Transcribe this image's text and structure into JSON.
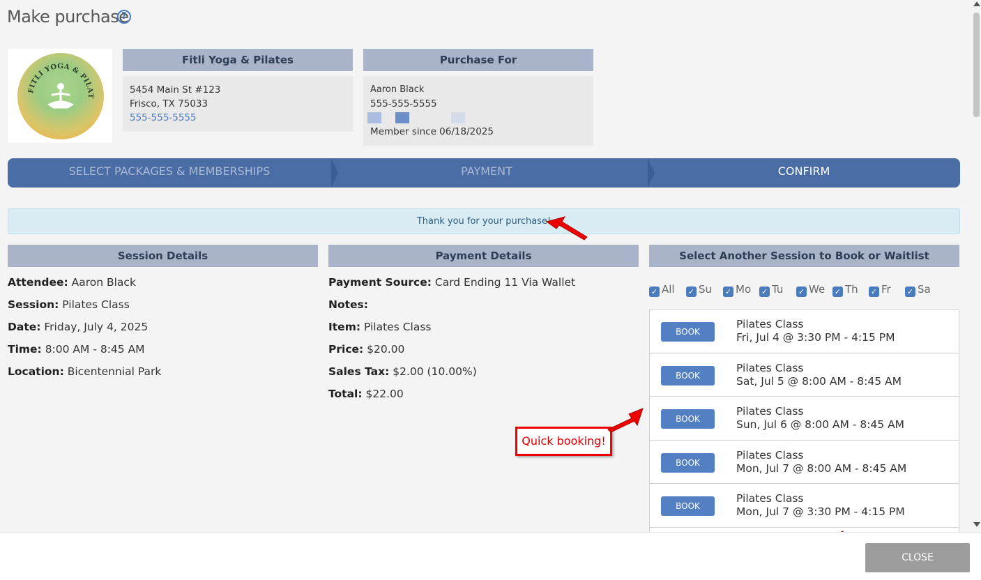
{
  "title": "Make purchase",
  "studio": {
    "name": "Fitli Yoga & Pilates",
    "address_line1": "5454 Main St #123",
    "address_line2": "Frisco, TX 75033",
    "phone": "555-555-5555",
    "logo_text": "FITLI YOGA & PILATES"
  },
  "purchase_for": {
    "header": "Purchase For",
    "name": "Aaron Black",
    "phone": "555-555-5555",
    "member_since": "Member since 06/18/2025",
    "swatch_colors": [
      "#a9bde0",
      "#6d8fc7",
      "#d4dbe9"
    ]
  },
  "steps": [
    {
      "label": "SELECT PACKAGES & MEMBERSHIPS",
      "active": false
    },
    {
      "label": "PAYMENT",
      "active": false
    },
    {
      "label": "CONFIRM",
      "active": true
    }
  ],
  "alert_text": "Thank you for your purchase!",
  "session_details": {
    "header": "Session Details",
    "rows": [
      {
        "label": "Attendee:",
        "value": "Aaron Black"
      },
      {
        "label": "Session:",
        "value": "Pilates Class"
      },
      {
        "label": "Date:",
        "value": "Friday, July 4, 2025"
      },
      {
        "label": "Time:",
        "value": "8:00 AM - 8:45 AM"
      },
      {
        "label": "Location:",
        "value": "Bicentennial Park"
      }
    ]
  },
  "payment_details": {
    "header": "Payment Details",
    "rows": [
      {
        "label": "Payment Source:",
        "value": "Card Ending 11 Via Wallet"
      },
      {
        "label": "Notes:",
        "value": ""
      },
      {
        "label": "Item:",
        "value": "Pilates Class"
      },
      {
        "label": "Price:",
        "value": "$20.00"
      },
      {
        "label": "Sales Tax:",
        "value": "$2.00 (10.00%)"
      },
      {
        "label": "Total:",
        "value": "$22.00"
      }
    ]
  },
  "booking": {
    "header": "Select Another Session to Book or Waitlist",
    "days": [
      "All",
      "Su",
      "Mo",
      "Tu",
      "We",
      "Th",
      "Fr",
      "Sa"
    ],
    "book_label": "BOOK",
    "sessions": [
      {
        "name": "Pilates Class",
        "time": "Fri, Jul 4 @ 3:30 PM - 4:15 PM"
      },
      {
        "name": "Pilates Class",
        "time": "Sat, Jul 5 @ 8:00 AM - 8:45 AM"
      },
      {
        "name": "Pilates Class",
        "time": "Sun, Jul 6 @ 8:00 AM - 8:45 AM"
      },
      {
        "name": "Pilates Class",
        "time": "Mon, Jul 7 @ 8:00 AM - 8:45 AM"
      },
      {
        "name": "Pilates Class",
        "time": "Mon, Jul 7 @ 3:30 PM - 4:15 PM"
      }
    ]
  },
  "callout_text": "Quick booking!",
  "close_label": "CLOSE",
  "colors": {
    "accent": "#4a6da5",
    "header_bar": "#a9b3c9",
    "book_button": "#5280c2",
    "annotation_red": "#e00000"
  }
}
